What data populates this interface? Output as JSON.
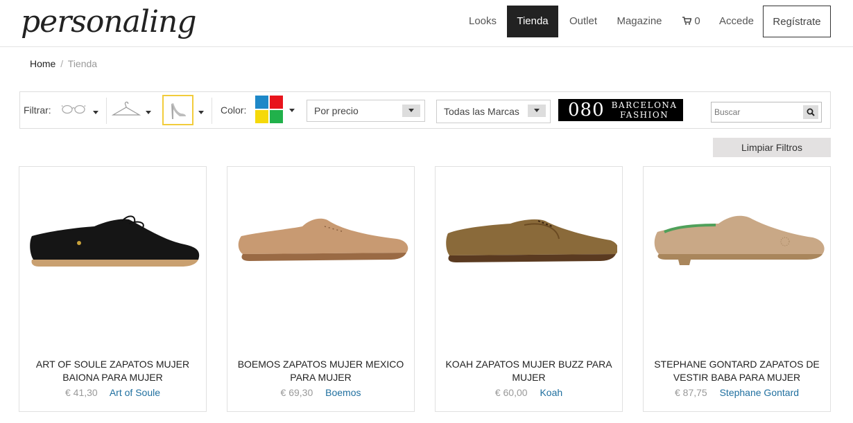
{
  "header": {
    "logo": "personaling",
    "nav": [
      {
        "label": "Looks"
      },
      {
        "label": "Tienda",
        "active": true
      },
      {
        "label": "Outlet"
      },
      {
        "label": "Magazine"
      }
    ],
    "cart_count": "0",
    "login_label": "Accede",
    "register_label": "Regístrate"
  },
  "breadcrumb": {
    "home": "Home",
    "separator": "/",
    "current": "Tienda"
  },
  "filters": {
    "filter_label": "Filtrar:",
    "category_icons": [
      "glasses-icon",
      "hanger-icon",
      "high-heel-shoe-icon"
    ],
    "selected_category": "high-heel-shoe-icon",
    "color_label": "Color:",
    "color_swatches": [
      "#1e88c8",
      "#e8141c",
      "#f5d90a",
      "#21b14b"
    ],
    "price_select": "Por precio",
    "brand_select": "Todas las Marcas",
    "banner": {
      "number": "080",
      "line1": "BARCELONA",
      "line2": "FASHION"
    },
    "search_placeholder": "Buscar",
    "clear_label": "Limpiar Filtros"
  },
  "products": [
    {
      "title": "ART OF SOULE ZAPATOS MUJER BAIONA PARA MUJER",
      "price": "€ 41,30",
      "brand": "Art of Soule",
      "shoe_color": "#151515",
      "sole_color": "#c9a070"
    },
    {
      "title": "BOEMOS ZAPATOS MUJER MEXICO PARA MUJER",
      "price": "€ 69,30",
      "brand": "Boemos",
      "shoe_color": "#c89a72",
      "sole_color": "#9a6a44"
    },
    {
      "title": "KOAH ZAPATOS MUJER BUZZ PARA MUJER",
      "price": "€ 60,00",
      "brand": "Koah",
      "shoe_color": "#8a6a3a",
      "sole_color": "#5a3a20"
    },
    {
      "title": "STEPHANE GONTARD ZAPATOS DE VESTIR BABA PARA MUJER",
      "price": "€ 87,75",
      "brand": "Stephane Gontard",
      "shoe_color": "#c9a886",
      "sole_color": "#a9865c"
    }
  ],
  "colors": {
    "accent_brand_link": "#1f6f9f",
    "active_nav_bg": "#222222",
    "selected_filter_border": "#f2cc3b"
  }
}
